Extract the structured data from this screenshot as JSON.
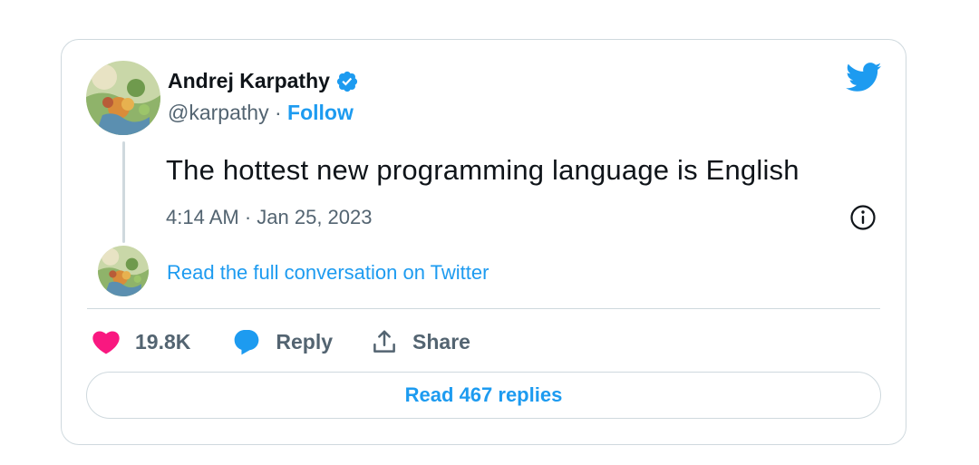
{
  "author": {
    "name": "Andrej Karpathy",
    "handle": "@karpathy",
    "separator": " · ",
    "follow_label": "Follow"
  },
  "icons": {
    "verified": "verified-badge-icon",
    "brand": "twitter-bird-icon",
    "info": "info-icon",
    "like": "heart-icon",
    "reply": "speech-bubble-icon",
    "share": "share-upload-icon"
  },
  "tweet": {
    "text": "The hottest new programming language is English",
    "timestamp": "4:14 AM · Jan 25, 2023"
  },
  "conversation_link": "Read the full conversation on Twitter",
  "actions": {
    "likes": "19.8K",
    "reply_label": "Reply",
    "share_label": "Share"
  },
  "read_replies_label": "Read 467 replies",
  "colors": {
    "accent": "#1d9bf0",
    "like": "#f91880",
    "text": "#0f1419",
    "muted": "#536471",
    "border": "#cfd9de"
  }
}
